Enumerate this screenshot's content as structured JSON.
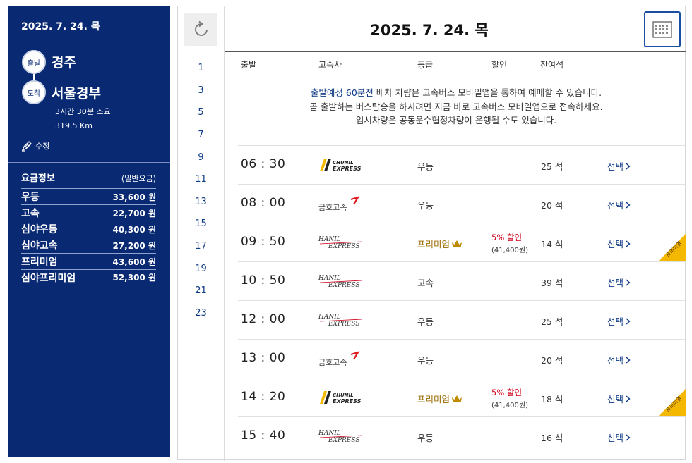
{
  "sidebar": {
    "date": "2025. 7. 24. 목",
    "departure_badge": "출발",
    "departure": "경주",
    "arrival_badge": "도착",
    "arrival": "서울경부",
    "duration": "3시간 30분 소요",
    "distance": "319.5 Km",
    "edit_label": "수정",
    "fare_title": "요금정보",
    "fare_type": "(일반요금)",
    "fares": [
      {
        "name": "우등",
        "price": "33,600 원"
      },
      {
        "name": "고속",
        "price": "22,700 원"
      },
      {
        "name": "심야우등",
        "price": "40,300 원"
      },
      {
        "name": "심야고속",
        "price": "27,200 원"
      },
      {
        "name": "프리미엄",
        "price": "43,600 원"
      },
      {
        "name": "심야프리미엄",
        "price": "52,300 원"
      }
    ]
  },
  "header": {
    "date": "2025. 7. 24. 목"
  },
  "hours": [
    "1",
    "3",
    "5",
    "7",
    "9",
    "11",
    "13",
    "15",
    "17",
    "19",
    "21",
    "23"
  ],
  "columns": {
    "departure": "출발",
    "company": "고속사",
    "grade": "등급",
    "discount": "할인",
    "seats": "잔여석"
  },
  "notice": {
    "highlight": "출발예정 60분전",
    "line1_rest": " 배차 차량은 고속버스 모바일앱을 통하여 예매할 수 있습니다.",
    "line2": "곧 출발하는 버스탑승을 하시려면 지금 바로 고속버스 모바일앱으로 접속하세요.",
    "line3": "임시차량은 공동운수협정차량이 운행될 수도 있습니다."
  },
  "logos": {
    "chunil_top": "CHUNIL",
    "chunil_bottom": "EXPRESS",
    "kumho": "금호고속",
    "hanil_top": "HANIL",
    "hanil_bottom": "EXPRESS"
  },
  "select_label": "선택",
  "ribbon_label": "프리미엄",
  "colors": {
    "sidebar_bg": "#092a73",
    "accent_blue": "#0d3a85",
    "discount_red": "#d0021b",
    "premium_gold": "#9a6a00",
    "ribbon_yellow": "#f5b800"
  },
  "buses": [
    {
      "time": "06 : 30",
      "company": "chunil",
      "grade": "우등",
      "premium": false,
      "discount": "",
      "discount_price": "",
      "seats": "25 석"
    },
    {
      "time": "08 : 00",
      "company": "kumho",
      "grade": "우등",
      "premium": false,
      "discount": "",
      "discount_price": "",
      "seats": "20 석"
    },
    {
      "time": "09 : 50",
      "company": "hanil",
      "grade": "프리미엄",
      "premium": true,
      "discount": "5% 할인",
      "discount_price": "(41,400원)",
      "seats": "14 석"
    },
    {
      "time": "10 : 50",
      "company": "hanil",
      "grade": "고속",
      "premium": false,
      "discount": "",
      "discount_price": "",
      "seats": "39 석"
    },
    {
      "time": "12 : 00",
      "company": "hanil",
      "grade": "우등",
      "premium": false,
      "discount": "",
      "discount_price": "",
      "seats": "25 석"
    },
    {
      "time": "13 : 00",
      "company": "kumho",
      "grade": "우등",
      "premium": false,
      "discount": "",
      "discount_price": "",
      "seats": "20 석"
    },
    {
      "time": "14 : 20",
      "company": "chunil",
      "grade": "프리미엄",
      "premium": true,
      "discount": "5% 할인",
      "discount_price": "(41,400원)",
      "seats": "18 석"
    },
    {
      "time": "15 : 40",
      "company": "hanil",
      "grade": "우등",
      "premium": false,
      "discount": "",
      "discount_price": "",
      "seats": "16 석"
    }
  ]
}
